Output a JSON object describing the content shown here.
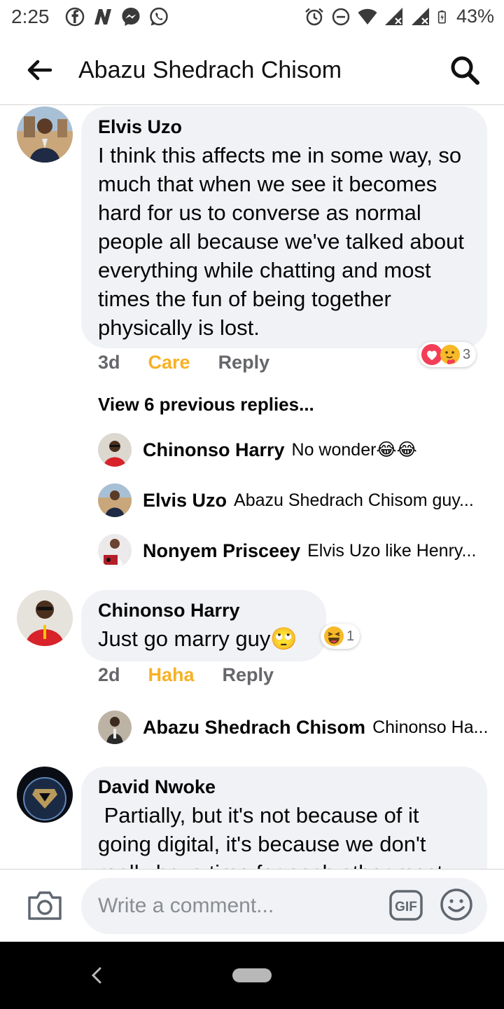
{
  "status_bar": {
    "time": "2:25",
    "battery": "43%",
    "icons_left": [
      "facebook-icon",
      "n-icon",
      "messenger-icon",
      "whatsapp-icon"
    ],
    "icons_right": [
      "alarm-icon",
      "dnd-icon",
      "wifi-icon",
      "signal-icon",
      "signal-icon",
      "battery-icon"
    ]
  },
  "header": {
    "title": "Abazu Shedrach Chisom"
  },
  "comments": [
    {
      "author": "Elvis Uzo",
      "text": "I think this affects me in some way, so much that when we see it becomes hard for us to converse as normal people all because we've talked about everything while chatting and most times the fun of being together physically is lost.",
      "age": "3d",
      "reaction": "Care",
      "reply_label": "Reply",
      "reaction_count": "3",
      "view_previous": "View 6 previous replies...",
      "replies": [
        {
          "author": "Chinonso Harry",
          "text": "No wonder😂😂"
        },
        {
          "author": "Elvis Uzo",
          "text": "Abazu Shedrach Chisom guy..."
        },
        {
          "author": "Nonyem Prisceey",
          "text": "Elvis Uzo like Henry..."
        }
      ]
    },
    {
      "author": "Chinonso Harry",
      "text": "Just go marry guy🙄",
      "age": "2d",
      "reaction": "Haha",
      "reply_label": "Reply",
      "reaction_count": "1",
      "replies": [
        {
          "author": "Abazu Shedrach Chisom",
          "text": "Chinonso Ha..."
        }
      ]
    },
    {
      "author": "David Nwoke",
      "text": " Partially, but it's not because of it going digital, it's because we don't really have time for each other most"
    }
  ],
  "composer": {
    "placeholder": "Write a comment...",
    "gif_label": "GIF"
  },
  "colors": {
    "bubble": "#f0f2f5",
    "reaction_yellow": "#f7b125",
    "meta_grey": "#65676b"
  }
}
